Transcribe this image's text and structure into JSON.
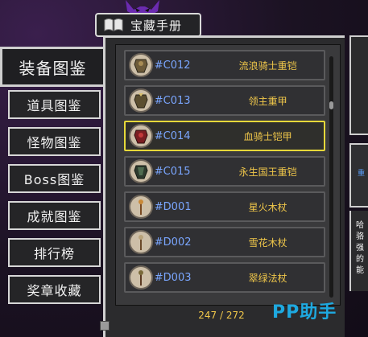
{
  "header": {
    "title": "宝藏手册",
    "book_icon": "book-icon",
    "mascot_icon": "demon-ears-icon"
  },
  "sidebar": {
    "items": [
      {
        "label": "装备图鉴",
        "active": true
      },
      {
        "label": "道具图鉴",
        "active": false
      },
      {
        "label": "怪物图鉴",
        "active": false
      },
      {
        "label": "Boss图鉴",
        "active": false
      },
      {
        "label": "成就图鉴",
        "active": false
      },
      {
        "label": "排行榜",
        "active": false
      },
      {
        "label": "奖章收藏",
        "active": false
      }
    ]
  },
  "list": {
    "items": [
      {
        "code": "#C012",
        "name": "流浪骑士重铠",
        "icon": "armor-icon",
        "selected": false
      },
      {
        "code": "#C013",
        "name": "领主重甲",
        "icon": "armor-icon",
        "selected": false
      },
      {
        "code": "#C014",
        "name": "血骑士铠甲",
        "icon": "armor-icon",
        "selected": true
      },
      {
        "code": "#C015",
        "name": "永生国王重铠",
        "icon": "armor-icon",
        "selected": false
      },
      {
        "code": "#D001",
        "name": "星火木杖",
        "icon": "staff-icon",
        "selected": false
      },
      {
        "code": "#D002",
        "name": "雪花木杖",
        "icon": "staff-icon",
        "selected": false
      },
      {
        "code": "#D003",
        "name": "翠绿法杖",
        "icon": "staff-icon",
        "selected": false
      }
    ],
    "counter": "247 / 272"
  },
  "detail": {
    "mid_label": "重",
    "desc_lines": [
      "哈",
      "骆",
      "强",
      "的",
      "能"
    ]
  },
  "watermark": "PP助手",
  "colors": {
    "accent": "#7b4fd0",
    "selected_border": "#e6d83a",
    "code": "#7aa6ff",
    "name": "#f0c74a"
  }
}
